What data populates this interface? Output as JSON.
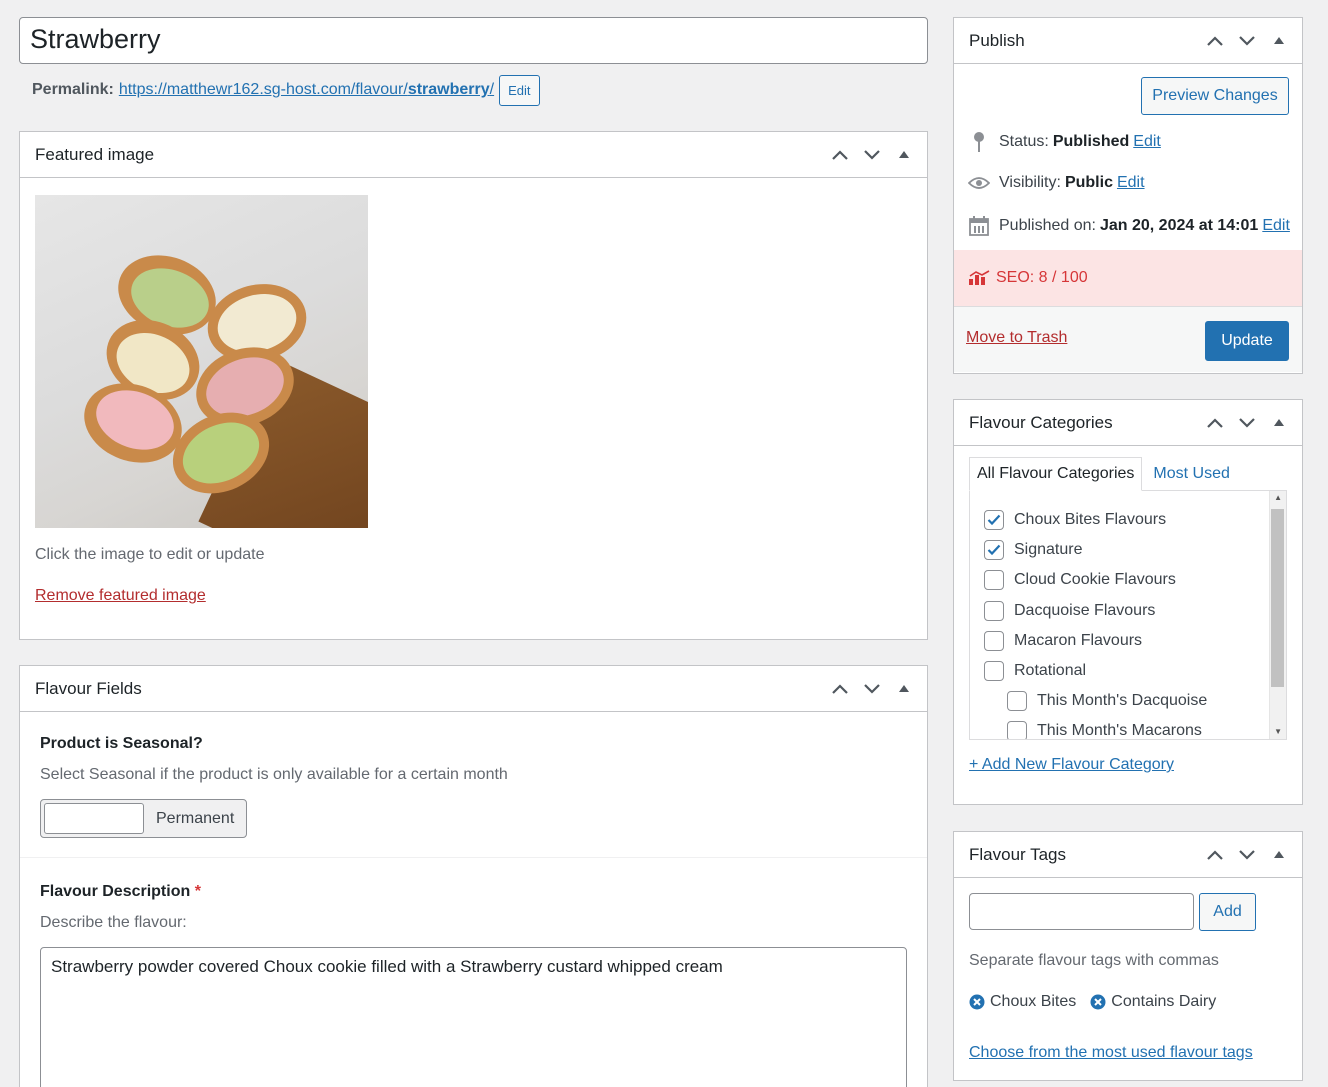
{
  "post": {
    "title": "Strawberry",
    "permalink_label": "Permalink:",
    "permalink_base": "https://matthewr162.sg-host.com/flavour/",
    "permalink_slug": "strawberry",
    "permalink_suffix": "/",
    "edit_label": "Edit"
  },
  "featured_image": {
    "title": "Featured image",
    "hint": "Click the image to edit or update",
    "remove_label": "Remove featured image"
  },
  "flavour_fields": {
    "title": "Flavour Fields",
    "seasonal_label": "Product is Seasonal?",
    "seasonal_desc": "Select Seasonal if the product is only available for a certain month",
    "switch_value": "Permanent",
    "desc_label": "Flavour Description",
    "required_mark": "*",
    "desc_hint": "Describe the flavour:",
    "desc_value": "Strawberry powder covered Choux cookie filled with a Strawberry custard whipped cream"
  },
  "publish": {
    "title": "Publish",
    "preview_label": "Preview Changes",
    "status_label": "Status:",
    "status_value": "Published",
    "visibility_label": "Visibility:",
    "visibility_value": "Public",
    "published_label": "Published on:",
    "published_value": "Jan 20, 2024 at 14:01",
    "edit_label": "Edit",
    "seo_label": "SEO: 8 / 100",
    "trash_label": "Move to Trash",
    "update_label": "Update"
  },
  "categories": {
    "title": "Flavour Categories",
    "tab_all": "All Flavour Categories",
    "tab_most_used": "Most Used",
    "items": [
      {
        "label": "Choux Bites Flavours",
        "checked": true,
        "child": false
      },
      {
        "label": "Signature",
        "checked": true,
        "child": false
      },
      {
        "label": "Cloud Cookie Flavours",
        "checked": false,
        "child": false
      },
      {
        "label": "Dacquoise Flavours",
        "checked": false,
        "child": false
      },
      {
        "label": "Macaron Flavours",
        "checked": false,
        "child": false
      },
      {
        "label": "Rotational",
        "checked": false,
        "child": false
      },
      {
        "label": "This Month's Dacquoise",
        "checked": false,
        "child": true
      },
      {
        "label": "This Month's Macarons",
        "checked": false,
        "child": true
      }
    ],
    "add_new_label": "+ Add New Flavour Category"
  },
  "tags": {
    "title": "Flavour Tags",
    "input_value": "",
    "add_label": "Add",
    "hint": "Separate flavour tags with commas",
    "items": [
      "Choux Bites",
      "Contains Dairy"
    ],
    "choose_label": "Choose from the most used flavour tags"
  },
  "colors": {
    "accent": "#2271b1",
    "danger": "#b32d2e",
    "seo_bg": "#fce4e4",
    "seo_text": "#d63638"
  }
}
